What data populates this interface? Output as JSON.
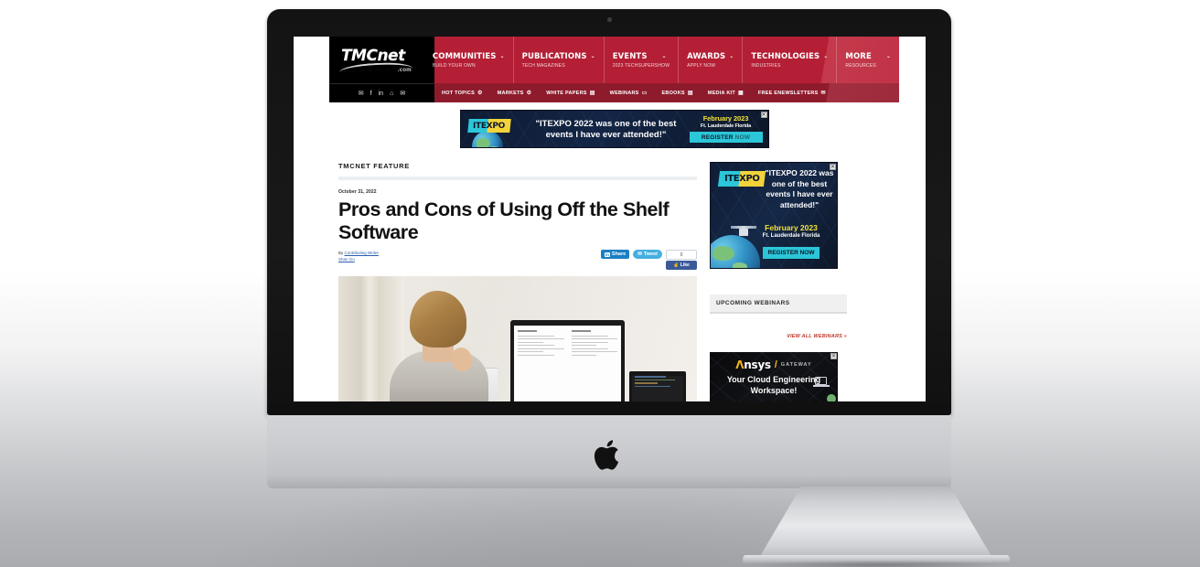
{
  "device": {
    "brand_logo": "apple-logo"
  },
  "site": {
    "logo_text": "TMCnet",
    "logo_domain": ".com",
    "nav": [
      {
        "title": "COMMUNITIES",
        "sub": "BUILD YOUR OWN",
        "caret": "⌄"
      },
      {
        "title": "PUBLICATIONS",
        "sub": "TECH MAGAZINES",
        "caret": "⌄"
      },
      {
        "title": "EVENTS",
        "sub": "2023 TECHSUPERSHOW",
        "caret": "⌄"
      },
      {
        "title": "AWARDS",
        "sub": "APPLY NOW",
        "caret": "⌄"
      },
      {
        "title": "TECHNOLOGIES",
        "sub": "INDUSTRIES",
        "caret": "⌄"
      },
      {
        "title": "MORE",
        "sub": "RESOURCES",
        "caret": "⌄"
      }
    ],
    "social": [
      {
        "name": "twitter-icon",
        "glyph": "✉"
      },
      {
        "name": "facebook-icon",
        "glyph": "f"
      },
      {
        "name": "linkedin-icon",
        "glyph": "in"
      },
      {
        "name": "rss-icon",
        "glyph": "⌂"
      },
      {
        "name": "email-icon",
        "glyph": "✉"
      }
    ],
    "sub_nav": [
      {
        "label": "HOT TOPICS",
        "glyph": "⚙"
      },
      {
        "label": "MARKETS",
        "glyph": "⚙"
      },
      {
        "label": "WHITE PAPERS",
        "glyph": "▤"
      },
      {
        "label": "WEBINARS",
        "glyph": "▭"
      },
      {
        "label": "EBOOKS",
        "glyph": "▤"
      },
      {
        "label": "MEDIA KIT",
        "glyph": "▦"
      },
      {
        "label": "FREE ENEWSLETTERS",
        "glyph": "✉"
      }
    ]
  },
  "leaderboard_ad": {
    "logo": "ITEXPO",
    "quote": "\"ITEXPO 2022 was one of the best events I have ever attended!\"",
    "date": "February 2023",
    "location": "Ft. Lauderdale Florida",
    "cta_strong": "REGISTER",
    "cta_dim": "NOW",
    "close": "✕"
  },
  "article": {
    "section_label": "TMCNET FEATURE",
    "date": "October 31, 2022",
    "title": "Pros and Cons of Using Off the Shelf Software",
    "byline_prefix": "By",
    "byline_author": "Contributing Writer",
    "byline_second": "Shan Go",
    "share": {
      "linkedin_glyph": "in",
      "linkedin_label": "Share",
      "twitter_glyph": "✉",
      "twitter_label": "Tweet",
      "facebook_count": "0",
      "facebook_glyph": "☝",
      "facebook_label": "Like"
    }
  },
  "sidebar": {
    "ad": {
      "logo": "ITEXPO",
      "quote": "\"ITEXPO 2022 was one of the best events I have ever attended!\"",
      "date": "February 2023",
      "location": "Ft. Lauderdale Florida",
      "cta": "REGISTER NOW",
      "close": "✕"
    },
    "webinars_panel": {
      "heading": "UPCOMING WEBINARS",
      "view_all": "VIEW ALL WEBINARS »"
    },
    "ansys_ad": {
      "brand_a": "Λ",
      "brand_rest": "nsys",
      "slash": "/",
      "product": "GATEWAY",
      "tagline": "Your Cloud Engineering Workspace!",
      "close": "✕"
    }
  }
}
